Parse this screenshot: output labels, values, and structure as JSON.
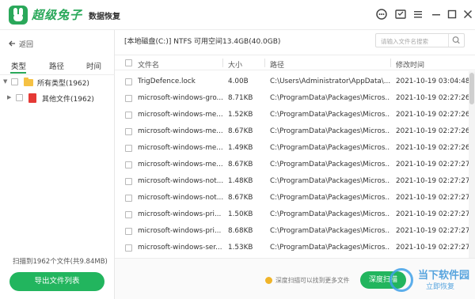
{
  "app": {
    "brand": "超级兔子",
    "subtitle": "数据恢复"
  },
  "sidebar": {
    "back_label": "返回",
    "tabs": [
      {
        "label": "类型"
      },
      {
        "label": "路径"
      },
      {
        "label": "时间"
      }
    ],
    "tree": [
      {
        "label": "所有类型(1962)"
      },
      {
        "label": "其他文件(1962)"
      }
    ],
    "scan_status": "扫描到1962个文件(共9.84MB)",
    "export_button": "导出文件列表"
  },
  "main": {
    "disk_info": "[本地磁盘(C:)] NTFS 可用空间13.4GB(40.0GB)",
    "search_placeholder": "请输入文件名搜索",
    "columns": {
      "name": "文件名",
      "size": "大小",
      "path": "路径",
      "modified": "修改时间"
    },
    "rows": [
      {
        "name": "TrigDefence.lock",
        "size": "4.00B",
        "path": "C:\\Users\\Administrator\\AppData\\...",
        "modified": "2021-10-19 03:04:48"
      },
      {
        "name": "microsoft-windows-gro...",
        "size": "8.71KB",
        "path": "C:\\ProgramData\\Packages\\Micros...",
        "modified": "2021-10-19 02:27:26"
      },
      {
        "name": "microsoft-windows-me...",
        "size": "1.52KB",
        "path": "C:\\ProgramData\\Packages\\Micros...",
        "modified": "2021-10-19 02:27:26"
      },
      {
        "name": "microsoft-windows-me...",
        "size": "8.67KB",
        "path": "C:\\ProgramData\\Packages\\Micros...",
        "modified": "2021-10-19 02:27:26"
      },
      {
        "name": "microsoft-windows-me...",
        "size": "1.49KB",
        "path": "C:\\ProgramData\\Packages\\Micros...",
        "modified": "2021-10-19 02:27:26"
      },
      {
        "name": "microsoft-windows-me...",
        "size": "8.67KB",
        "path": "C:\\ProgramData\\Packages\\Micros...",
        "modified": "2021-10-19 02:27:27"
      },
      {
        "name": "microsoft-windows-not...",
        "size": "1.48KB",
        "path": "C:\\ProgramData\\Packages\\Micros...",
        "modified": "2021-10-19 02:27:27"
      },
      {
        "name": "microsoft-windows-not...",
        "size": "8.67KB",
        "path": "C:\\ProgramData\\Packages\\Micros...",
        "modified": "2021-10-19 02:27:27"
      },
      {
        "name": "microsoft-windows-pri...",
        "size": "1.50KB",
        "path": "C:\\ProgramData\\Packages\\Micros...",
        "modified": "2021-10-19 02:27:27"
      },
      {
        "name": "microsoft-windows-pri...",
        "size": "8.68KB",
        "path": "C:\\ProgramData\\Packages\\Micros...",
        "modified": "2021-10-19 02:27:27"
      },
      {
        "name": "microsoft-windows-ser...",
        "size": "1.53KB",
        "path": "C:\\ProgramData\\Packages\\Micros...",
        "modified": "2021-10-19 02:27:27"
      }
    ],
    "tip": "深度扫描可以找到更多文件",
    "deep_scan_button": "深度扫描"
  },
  "watermark": {
    "line1": "当下软件园",
    "line2": "立即恢复"
  },
  "colors": {
    "accent": "#22b55e",
    "brand_green": "#2aa85a",
    "folder": "#f5c143",
    "file_red": "#e53935"
  },
  "icons": [
    "back-arrow-icon",
    "support-icon",
    "feedback-icon",
    "menu-icon",
    "minimize-icon",
    "maximize-icon",
    "close-icon",
    "search-icon",
    "folder-icon",
    "file-icon",
    "tip-icon"
  ]
}
